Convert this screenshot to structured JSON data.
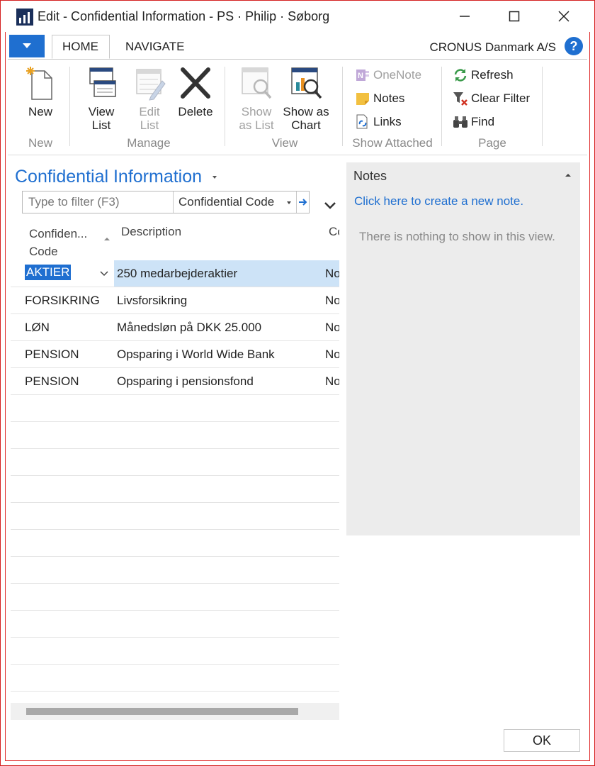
{
  "window": {
    "title": "Edit - Confidential Information - PS · Philip · Søborg"
  },
  "tabs": [
    {
      "label": "HOME"
    },
    {
      "label": "NAVIGATE"
    }
  ],
  "company": "CRONUS Danmark A/S",
  "ribbon": {
    "new_label": "New",
    "view_list_label": [
      "View",
      "List"
    ],
    "edit_list_label": [
      "Edit",
      "List"
    ],
    "delete_label": "Delete",
    "show_as_list_label": [
      "Show",
      "as List"
    ],
    "show_as_chart_label": [
      "Show as",
      "Chart"
    ],
    "onenote_label": "OneNote",
    "notes_label": "Notes",
    "links_label": "Links",
    "refresh_label": "Refresh",
    "clear_filter_label": "Clear Filter",
    "find_label": "Find",
    "groups": {
      "new": "New",
      "manage": "Manage",
      "view": "View",
      "show_attached": "Show Attached",
      "page": "Page"
    }
  },
  "list": {
    "title": "Confidential Information",
    "filter_placeholder": "Type to filter (F3)",
    "filter_field": "Confidential Code",
    "columns": {
      "code": [
        "Confiden...",
        "Code"
      ],
      "description": "Description",
      "third": "Co"
    },
    "rows": [
      {
        "code": "AKTIER",
        "description": "250 medarbejderaktier",
        "third": "No"
      },
      {
        "code": "FORSIKRING",
        "description": "Livsforsikring",
        "third": "No"
      },
      {
        "code": "LØN",
        "description": "Månedsløn på DKK 25.000",
        "third": "No"
      },
      {
        "code": "PENSION",
        "description": "Opsparing i World Wide Bank",
        "third": "No"
      },
      {
        "code": "PENSION",
        "description": "Opsparing i pensionsfond",
        "third": "No"
      }
    ]
  },
  "notes": {
    "title": "Notes",
    "create_link": "Click here to create a new note.",
    "empty_text": "There is nothing to show in this view."
  },
  "ok_label": "OK",
  "colors": {
    "accent": "#1f6fd0",
    "selection": "#cde3f7",
    "frame": "#d42020"
  }
}
